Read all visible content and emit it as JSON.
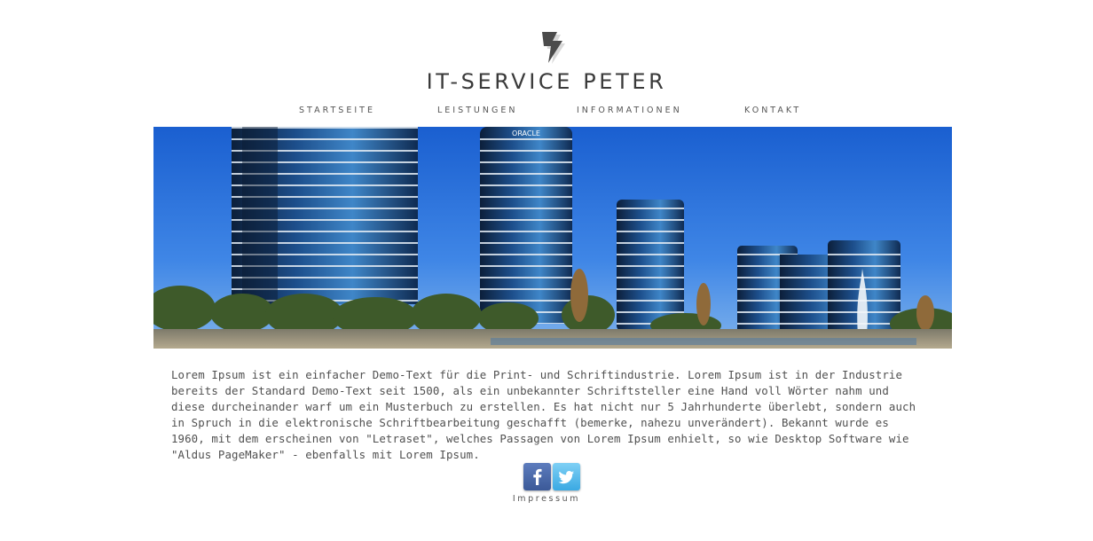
{
  "header": {
    "logo_icon": "lightning-bolt-icon",
    "title": "IT-SERVICE PETER"
  },
  "nav": {
    "items": [
      {
        "label": "STARTSEITE"
      },
      {
        "label": "LEISTUNGEN"
      },
      {
        "label": "INFORMATIONEN"
      },
      {
        "label": "KONTAKT"
      }
    ]
  },
  "hero": {
    "image": "office-towers-photo",
    "sign_text": "ORACLE"
  },
  "content": {
    "text": "Lorem Ipsum ist ein einfacher Demo-Text für die Print- und Schriftindustrie. Lorem Ipsum ist in der Industrie bereits der Standard Demo-Text seit 1500, als ein unbekannter Schriftsteller eine Hand voll Wörter nahm und diese durcheinander warf um ein Musterbuch zu erstellen. Es hat nicht nur 5 Jahrhunderte überlebt, sondern auch in Spruch in die elektronische Schriftbearbeitung geschafft (bemerke, nahezu unverändert). Bekannt wurde es 1960, mit dem erscheinen von \"Letraset\", welches Passagen von Lorem Ipsum enhielt, so wie Desktop Software wie \"Aldus PageMaker\" - ebenfalls mit Lorem Ipsum."
  },
  "footer": {
    "social": [
      {
        "icon": "facebook-icon",
        "color": "#3b5998"
      },
      {
        "icon": "twitter-icon",
        "color": "#3aa9e3"
      }
    ],
    "impressum_label": "Impressum"
  }
}
